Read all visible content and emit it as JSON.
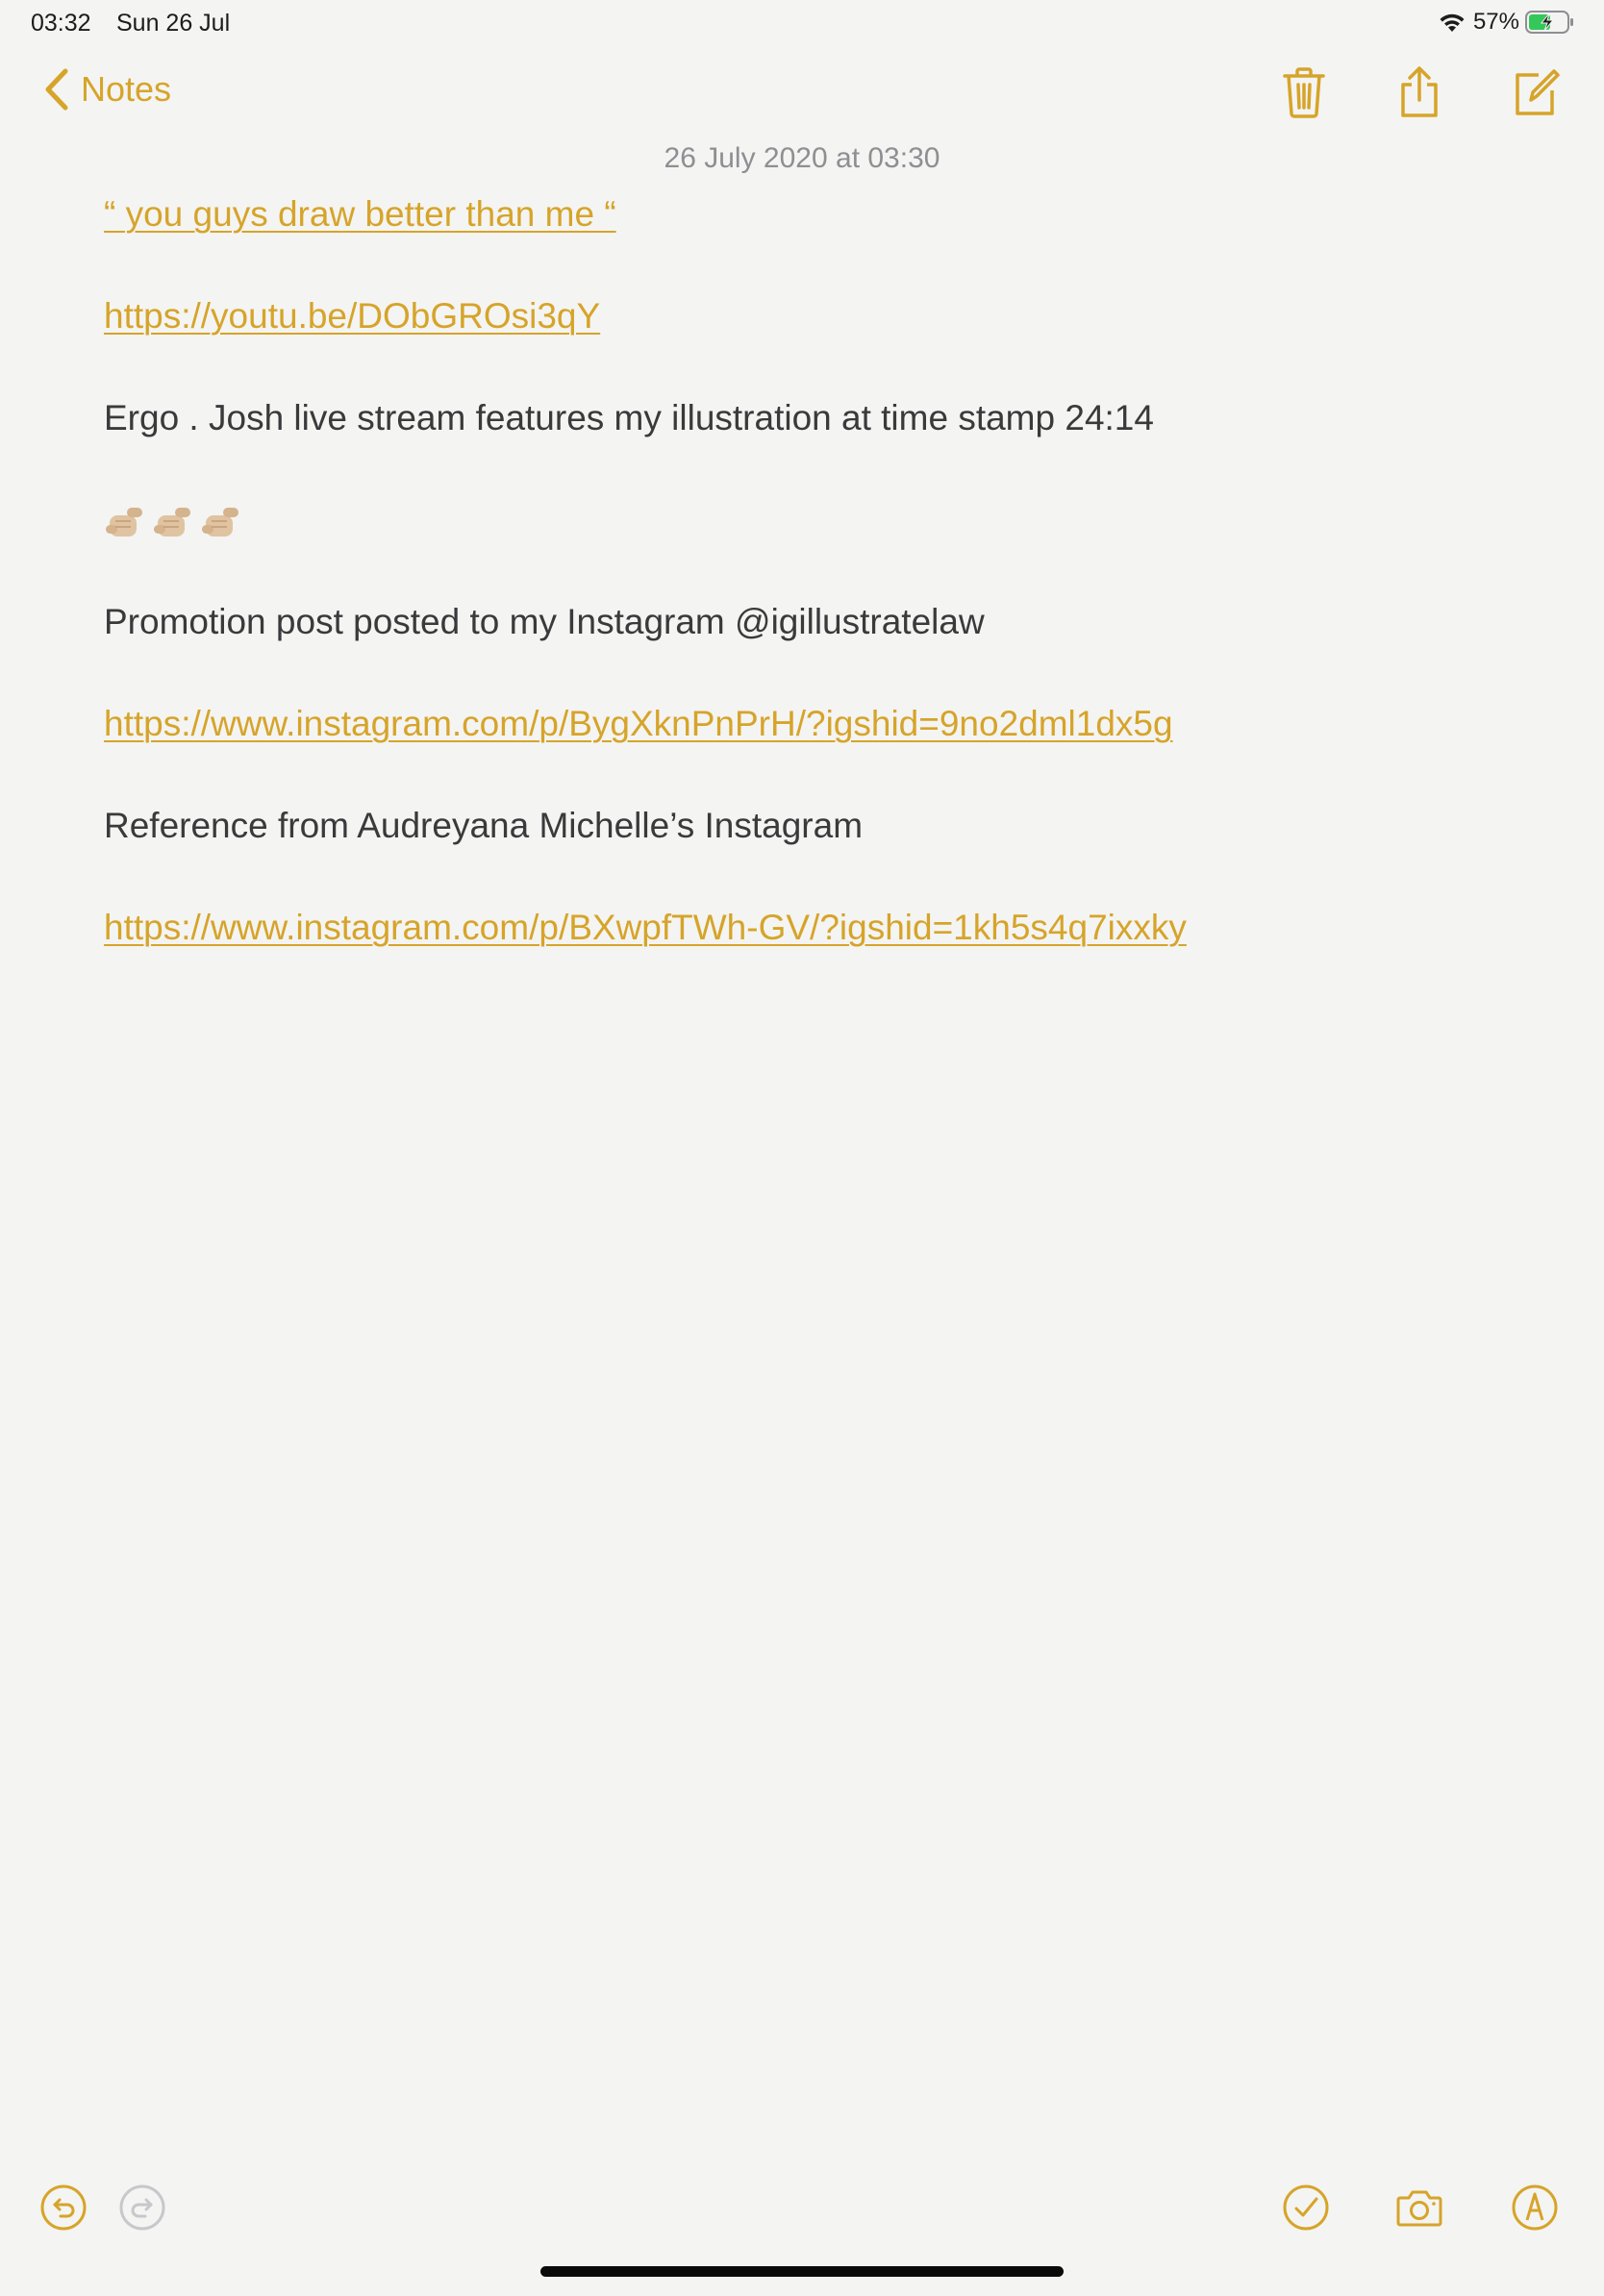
{
  "status_bar": {
    "time": "03:32",
    "date": "Sun 26 Jul",
    "battery": "57%"
  },
  "nav": {
    "back_label": "Notes",
    "back_icon": "chevron-left-icon",
    "actions": [
      "trash-icon",
      "share-icon",
      "compose-icon"
    ]
  },
  "note": {
    "date": "26 July 2020 at 03:30",
    "lines": {
      "quote": "“ you guys draw better than me “",
      "youtube_link": "https://youtu.be/DObGROsi3qY",
      "ergo": "Ergo . Josh live stream features my illustration at time stamp 24:14",
      "emoji": "🤙🏼🤙🏼🤙🏼",
      "promotion": "Promotion post posted to my Instagram @igillustratelaw",
      "instagram_link_1": "https://www.instagram.com/p/BygXknPnPrH/?igshid=9no2dml1dx5g",
      "reference": "Reference from Audreyana Michelle’s Instagram",
      "instagram_link_2": "https://www.instagram.com/p/BXwpfTWh-GV/?igshid=1kh5s4q7ixxky"
    }
  },
  "toolbar": {
    "left": [
      "undo-icon",
      "redo-icon"
    ],
    "right": [
      "checklist-icon",
      "camera-icon",
      "markup-icon"
    ]
  },
  "colors": {
    "accent": "#d6a42a",
    "text": "#3a3a3c",
    "secondary_text": "#8e8e93",
    "background": "#f4f4f2"
  }
}
